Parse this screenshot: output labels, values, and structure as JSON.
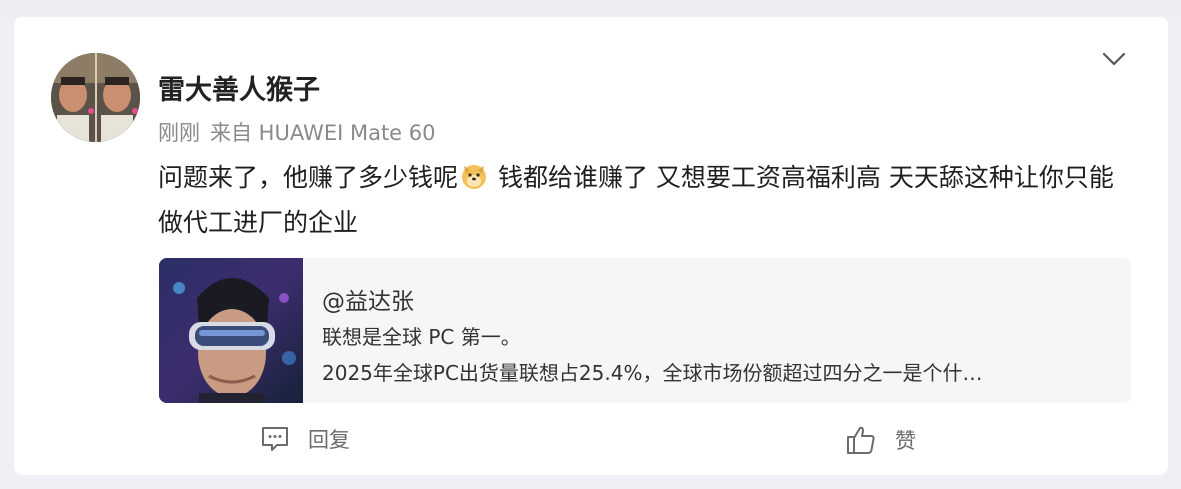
{
  "post": {
    "username": "雷大善人猴子",
    "time": "刚刚",
    "source": "来自 HUAWEI Mate 60",
    "text_part1": "问题来了，他赚了多少钱呢",
    "emoji": "doge-emoji",
    "text_part2": " 钱都给谁赚了 又想要工资高福利高 天天舔这种让你只能做代工进厂的企业"
  },
  "quote": {
    "author": "@益达张",
    "line1": "联想是全球 PC 第一。",
    "line2": "2025年全球PC出货量联想占25.4%，全球市场份额超过四分之一是个什…"
  },
  "actions": {
    "reply_label": "回复",
    "like_label": "赞"
  },
  "icons": {
    "menu": "chevron-down-icon",
    "reply": "comment-icon",
    "like": "thumbs-up-icon"
  }
}
